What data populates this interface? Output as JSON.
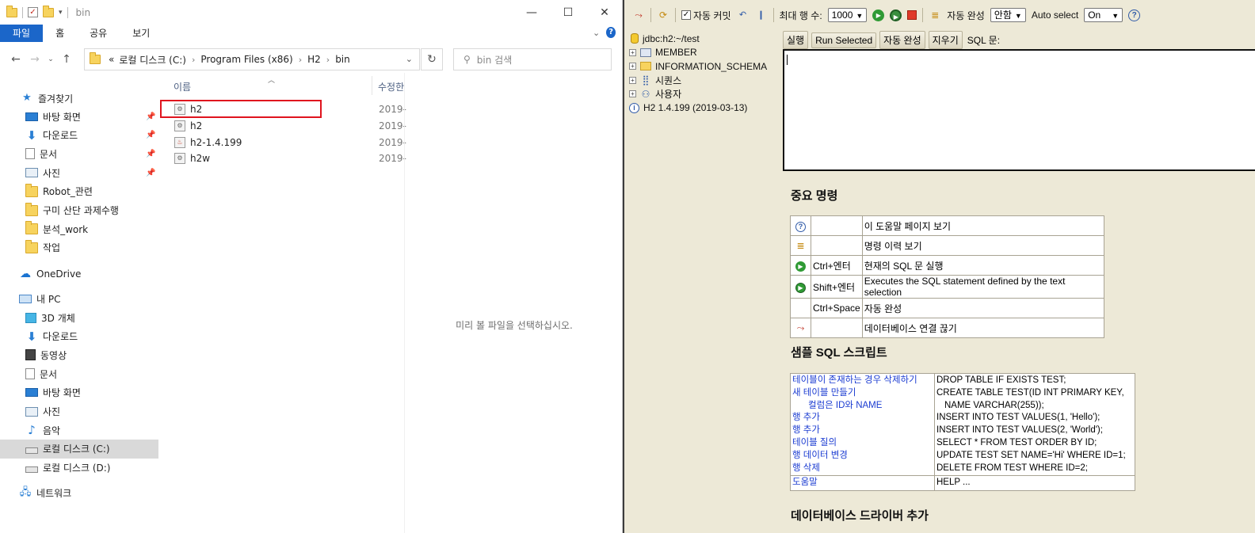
{
  "explorer": {
    "title": "bin",
    "tabs": [
      {
        "label": "파일",
        "active": true
      },
      {
        "label": "홈",
        "active": false
      },
      {
        "label": "공유",
        "active": false
      },
      {
        "label": "보기",
        "active": false
      }
    ],
    "address": {
      "prefix": "«",
      "crumbs": [
        "로컬 디스크 (C:)",
        "Program Files (x86)",
        "H2",
        "bin"
      ]
    },
    "search_placeholder": "bin 검색",
    "nav": {
      "quick_access": "즐겨찾기",
      "quick_items": [
        {
          "label": "바탕 화면",
          "icon": "desktop-icon",
          "pinned": true
        },
        {
          "label": "다운로드",
          "icon": "download-icon",
          "pinned": true
        },
        {
          "label": "문서",
          "icon": "document-icon",
          "pinned": true
        },
        {
          "label": "사진",
          "icon": "pictures-icon",
          "pinned": true
        },
        {
          "label": "Robot_관련",
          "icon": "folder-icon",
          "pinned": false
        },
        {
          "label": "구미 산단 과제수행",
          "icon": "folder-icon",
          "pinned": false
        },
        {
          "label": "분석_work",
          "icon": "folder-icon",
          "pinned": false
        },
        {
          "label": "작업",
          "icon": "folder-icon",
          "pinned": false
        }
      ],
      "onedrive": "OneDrive",
      "this_pc": "내 PC",
      "pc_items": [
        {
          "label": "3D 개체",
          "icon": "3d-objects-icon"
        },
        {
          "label": "다운로드",
          "icon": "download-icon"
        },
        {
          "label": "동영상",
          "icon": "video-icon"
        },
        {
          "label": "문서",
          "icon": "document-icon"
        },
        {
          "label": "바탕 화면",
          "icon": "desktop-icon"
        },
        {
          "label": "사진",
          "icon": "pictures-icon"
        },
        {
          "label": "음악",
          "icon": "music-icon"
        },
        {
          "label": "로컬 디스크 (C:)",
          "icon": "drive-icon",
          "selected": true
        },
        {
          "label": "로컬 디스크 (D:)",
          "icon": "drive-icon"
        }
      ],
      "network": "네트워크"
    },
    "columns": {
      "name": "이름",
      "modified": "수정한"
    },
    "files": [
      {
        "name": "h2",
        "date": "2019-",
        "type": "batch",
        "highlighted": true
      },
      {
        "name": "h2",
        "date": "2019-",
        "type": "batch"
      },
      {
        "name": "h2-1.4.199",
        "date": "2019-",
        "type": "jar"
      },
      {
        "name": "h2w",
        "date": "2019-",
        "type": "batch"
      }
    ],
    "preview_text": "미리 볼 파일을 선택하십시오."
  },
  "h2": {
    "toolbar": {
      "autocommit_label": "자동 커밋",
      "autocommit_checked": true,
      "max_rows_label": "최대 행 수:",
      "max_rows_value": "1000",
      "autocomplete_label": "자동 완성",
      "autocomplete_value": "안함",
      "autoselect_label": "Auto select",
      "autoselect_value": "On"
    },
    "tree": {
      "connection": "jdbc:h2:~/test",
      "nodes": [
        {
          "label": "MEMBER",
          "icon": "table-icon"
        },
        {
          "label": "INFORMATION_SCHEMA",
          "icon": "folder-icon"
        },
        {
          "label": "시퀀스",
          "icon": "sequence-icon"
        },
        {
          "label": "사용자",
          "icon": "users-icon"
        }
      ],
      "version": "H2 1.4.199 (2019-03-13)"
    },
    "sql_buttons": [
      "실행",
      "Run Selected",
      "자동 완성",
      "지우기"
    ],
    "sql_label": "SQL 문:",
    "sql_text": "",
    "important_heading": "중요 명령",
    "commands": [
      {
        "icon": "help-icon",
        "key": "",
        "desc": "이 도움말 페이지 보기"
      },
      {
        "icon": "history-icon",
        "key": "",
        "desc": "명령 이력 보기"
      },
      {
        "icon": "run-icon",
        "key": "Ctrl+엔터",
        "desc": "현재의 SQL 문 실행"
      },
      {
        "icon": "run-selected-icon",
        "key": "Shift+엔터",
        "desc": "Executes the SQL statement defined by the text selection"
      },
      {
        "icon": "",
        "key": "Ctrl+Space",
        "desc": "자동 완성"
      },
      {
        "icon": "disconnect-icon",
        "key": "",
        "desc": "데이터베이스 연결 끊기"
      }
    ],
    "sample_heading": "샘플 SQL 스크립트",
    "sample_rows": [
      {
        "label": "테이블이 존재하는 경우 삭제하기",
        "sql": "DROP TABLE IF EXISTS TEST;"
      },
      {
        "label": "새 테이블 만들기",
        "sql": "CREATE TABLE TEST(ID INT PRIMARY KEY,"
      },
      {
        "label": "컬럼은 ID와 NAME",
        "sql": "NAME VARCHAR(255));",
        "indent": true
      },
      {
        "label": "행 추가",
        "sql": "INSERT INTO TEST VALUES(1, 'Hello');"
      },
      {
        "label": "행 추가",
        "sql": "INSERT INTO TEST VALUES(2, 'World');"
      },
      {
        "label": "테이블 질의",
        "sql": "SELECT * FROM TEST ORDER BY ID;"
      },
      {
        "label": "행 데이터 변경",
        "sql": "UPDATE TEST SET NAME='Hi' WHERE ID=1;"
      },
      {
        "label": "행 삭제",
        "sql": "DELETE FROM TEST WHERE ID=2;"
      }
    ],
    "help_row": {
      "label": "도움말",
      "sql": "HELP ..."
    },
    "driver_heading": "데이터베이스 드라이버 추가"
  }
}
